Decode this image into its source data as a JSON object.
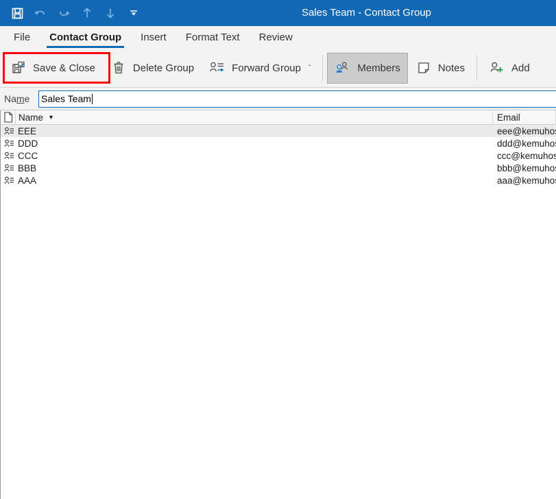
{
  "window": {
    "title": "Sales Team  -  Contact Group",
    "titlebar_color": "#1268b3"
  },
  "quick_access_toolbar": {
    "items": [
      {
        "name": "save-icon",
        "tooltip": "Save"
      },
      {
        "name": "undo-icon",
        "tooltip": "Undo"
      },
      {
        "name": "redo-icon",
        "tooltip": "Redo"
      },
      {
        "name": "previous-item-icon",
        "tooltip": "Previous Item"
      },
      {
        "name": "next-item-icon",
        "tooltip": "Next Item"
      },
      {
        "name": "customize-quick-access-toolbar-icon",
        "tooltip": "Customize Quick Access Toolbar"
      }
    ]
  },
  "tabs": [
    {
      "label": "File",
      "active": false
    },
    {
      "label": "Contact Group",
      "active": true
    },
    {
      "label": "Insert",
      "active": false
    },
    {
      "label": "Format Text",
      "active": false
    },
    {
      "label": "Review",
      "active": false
    }
  ],
  "ribbon": {
    "save_close_label": "Save & Close",
    "delete_group_label": "Delete Group",
    "forward_group_label": "Forward Group",
    "forward_group_chevron": "ˇ",
    "members_label": "Members",
    "notes_label": "Notes",
    "add_label": "Add",
    "highlight_color": "#fa0202"
  },
  "name_field": {
    "label_before": "Na",
    "label_accel": "m",
    "label_after": "e",
    "value": "Sales Team",
    "placeholder": ""
  },
  "list": {
    "columns": [
      {
        "key": "icon",
        "label": ""
      },
      {
        "key": "name",
        "label": "Name",
        "sorted": true,
        "sort_arrow": "▼"
      },
      {
        "key": "email",
        "label": "Email"
      }
    ],
    "rows": [
      {
        "name": "EEE",
        "email": "eee@kemuhost.",
        "selected": true
      },
      {
        "name": "DDD",
        "email": "ddd@kemuhost",
        "selected": false
      },
      {
        "name": "CCC",
        "email": "ccc@kemuhost.",
        "selected": false
      },
      {
        "name": "BBB",
        "email": "bbb@kemuhost.",
        "selected": false
      },
      {
        "name": "AAA",
        "email": "aaa@kemuhost.",
        "selected": false
      }
    ]
  }
}
